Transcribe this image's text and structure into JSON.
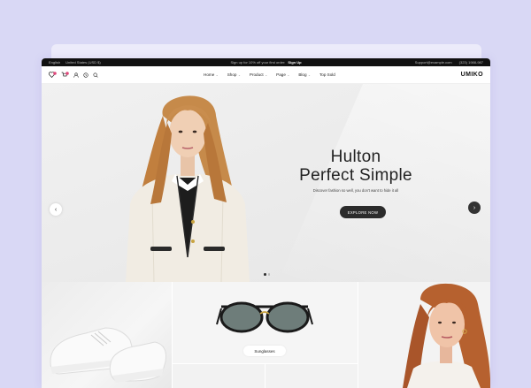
{
  "colors": {
    "page_bg": "#d9d8f5",
    "accent_dark": "#2b2b2b",
    "topbar_bg": "#111111"
  },
  "topbar": {
    "language": "English",
    "currency": "United States (USD $)",
    "promo_text": "Sign up for 10% off your first order:",
    "promo_link": "Sign Up",
    "email": "Support@example.com",
    "phone": "(323) 1988-987"
  },
  "nav": {
    "icons": [
      "wishlist-icon",
      "cart-icon",
      "account-icon",
      "history-icon",
      "search-icon"
    ],
    "menu": [
      {
        "label": "Home",
        "has_dropdown": true
      },
      {
        "label": "Shop",
        "has_dropdown": true
      },
      {
        "label": "Product",
        "has_dropdown": true
      },
      {
        "label": "Page",
        "has_dropdown": true
      },
      {
        "label": "Blog",
        "has_dropdown": true
      },
      {
        "label": "Top Sold",
        "has_dropdown": false
      }
    ],
    "logo": "UMIKO"
  },
  "hero": {
    "title_line1": "Hulton",
    "title_line2": "Perfect Simple",
    "subtitle": "Discover fashion so well, you don't want to hide it all",
    "button": "EXPLORE NOW",
    "slides": 2,
    "active_slide": 1
  },
  "collections": {
    "glasses_label": "Sunglasses"
  }
}
